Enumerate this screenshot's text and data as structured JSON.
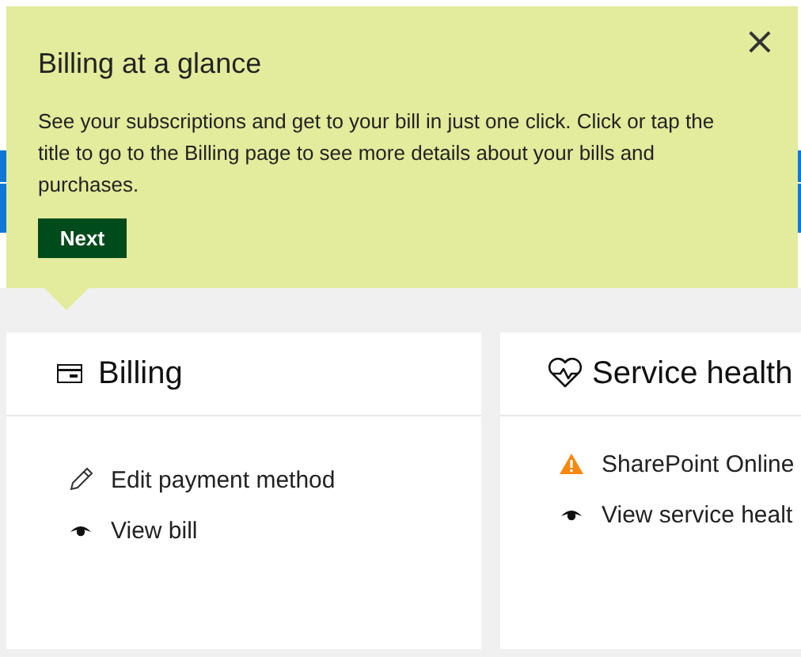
{
  "tooltip": {
    "title": "Billing at a glance",
    "body": "See your subscriptions and get to your bill in just one click. Click or tap the title to go to the Billing page to see more details about your bills and purchases.",
    "button": "Next",
    "close": "×"
  },
  "cards": [
    {
      "kind": "billing",
      "title": "Billing",
      "items": [
        {
          "kind": "edit",
          "label": "Edit payment method"
        },
        {
          "kind": "view",
          "label": "View bill"
        }
      ]
    },
    {
      "kind": "health",
      "title": "Service health",
      "items": [
        {
          "kind": "alert",
          "label": "SharePoint Online"
        },
        {
          "kind": "view",
          "label": "View service healt"
        }
      ]
    }
  ]
}
